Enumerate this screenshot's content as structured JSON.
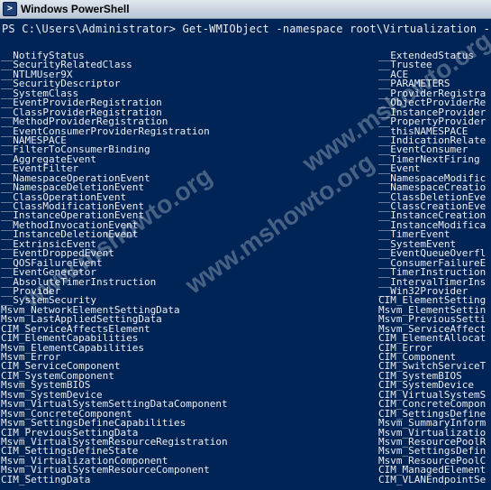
{
  "window": {
    "title": "Windows PowerShell"
  },
  "prompt": "PS C:\\Users\\Administrator> Get-WMIObject -namespace root\\Virtualization -list |",
  "left_column": [
    "__NotifyStatus",
    "__SecurityRelatedClass",
    "__NTLMUser9X",
    "__SecurityDescriptor",
    "__SystemClass",
    "__EventProviderRegistration",
    "__ClassProviderRegistration",
    "__MethodProviderRegistration",
    "__EventConsumerProviderRegistration",
    "__NAMESPACE",
    "__FilterToConsumerBinding",
    "__AggregateEvent",
    "__EventFilter",
    "__NamespaceOperationEvent",
    "__NamespaceDeletionEvent",
    "__ClassOperationEvent",
    "__ClassModificationEvent",
    "__InstanceOperationEvent",
    "__MethodInvocationEvent",
    "__InstanceDeletionEvent",
    "__ExtrinsicEvent",
    "__EventDroppedEvent",
    "__QOSFailureEvent",
    "__EventGenerator",
    "__AbsoluteTimerInstruction",
    "__Provider",
    "__SystemSecurity",
    "Msvm_NetworkElementSettingData",
    "Msvm_LastAppliedSettingData",
    "CIM_ServiceAffectsElement",
    "CIM_ElementCapabilities",
    "Msvm_ElementCapabilities",
    "Msvm_Error",
    "CIM_ServiceComponent",
    "CIM_SystemComponent",
    "Msvm_SystemBIOS",
    "Msvm_SystemDevice",
    "Msvm_VirtualSystemSettingDataComponent",
    "Msvm_ConcreteComponent",
    "Msvm_SettingsDefineCapabilities",
    "CIM_PreviousSettingData",
    "Msvm_VirtualSystemResourceRegistration",
    "CIM_SettingsDefineState",
    "Msvm_VirtualizationComponent",
    "Msvm_VirtualSystemResourceComponent",
    "CIM_SettingData"
  ],
  "right_column": [
    "__ExtendedStatus",
    "__Trustee",
    "__ACE",
    "__PARAMETERS",
    "__ProviderRegistra",
    "__ObjectProviderRe",
    "__InstanceProvider",
    "__PropertyProvider",
    "__thisNAMESPACE",
    "__IndicationRelate",
    "__EventConsumer",
    "__TimerNextFiring",
    "__Event",
    "__NamespaceModific",
    "__NamespaceCreatio",
    "__ClassDeletionEve",
    "__ClassCreationEve",
    "__InstanceCreation",
    "__InstanceModifica",
    "__TimerEvent",
    "__SystemEvent",
    "__EventQueueOverfl",
    "__ConsumerFailureE",
    "__TimerInstruction",
    "__IntervalTimerIns",
    "__Win32Provider",
    "CIM_ElementSetting",
    "Msvm_ElementSettin",
    "Msvm_PreviousSetti",
    "Msvm_ServiceAffect",
    "CIM_ElementAllocat",
    "CIM_Error",
    "CIM_Component",
    "CIM_SwitchServiceT",
    "CIM_SystemBIOS",
    "CIM_SystemDevice",
    "CIM_VirtualSystemS",
    "CIM_ConcreteCompon",
    "CIM_SettingsDefine",
    "Msvm_SummaryInform",
    "Msvm_Virtualizatio",
    "Msvm_ResourcePoolR",
    "Msvm_SettingsDefin",
    "Msvm_ResourcePoolC",
    "CIM_ManagedElement",
    "CIM_VLANEndpointSe"
  ],
  "watermark": "www.mshowto.org"
}
